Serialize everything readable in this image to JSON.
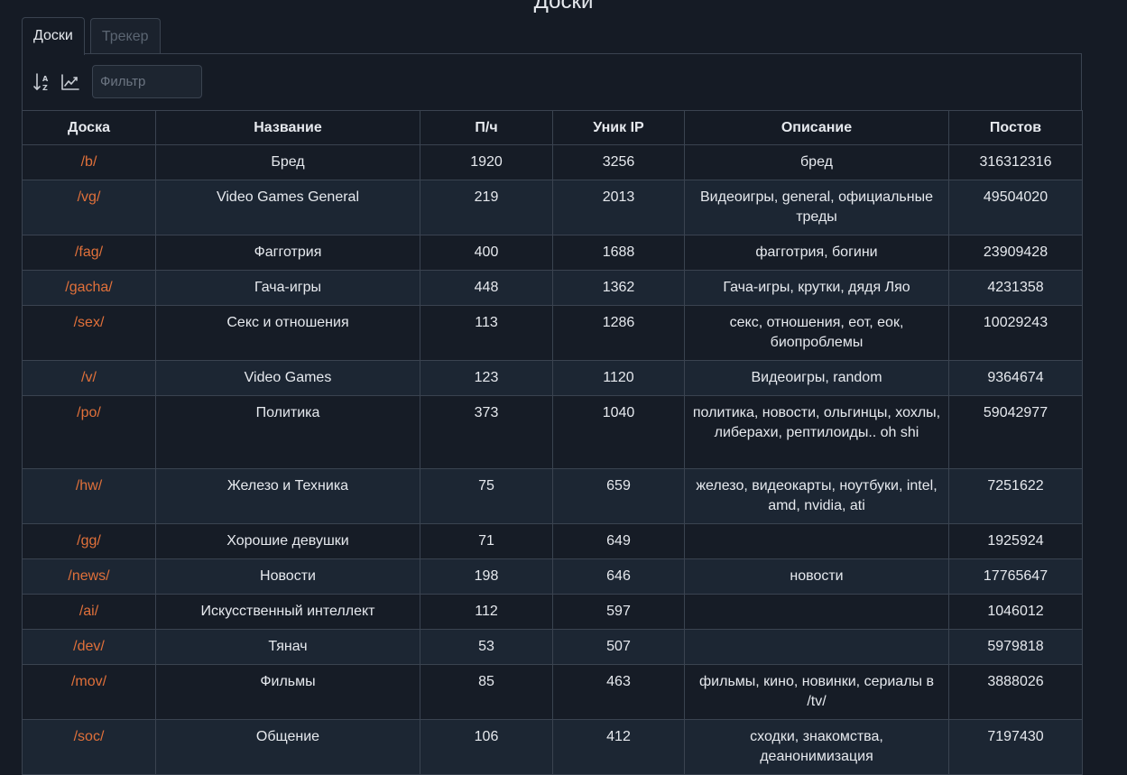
{
  "page": {
    "title": "Доски"
  },
  "tabs": [
    {
      "label": "Доски",
      "active": true
    },
    {
      "label": "Трекер",
      "active": false
    }
  ],
  "toolbar": {
    "sort_icon": "sort-alpha-icon",
    "chart_icon": "line-chart-icon",
    "filter_placeholder": "Фильтр",
    "filter_value": ""
  },
  "colors": {
    "background": "#151b25",
    "row_alt": "#1c2633",
    "border": "#3a4350",
    "link": "#e0703a",
    "text": "#e6e9ee"
  },
  "table": {
    "headers": [
      "Доска",
      "Название",
      "П/ч",
      "Уник IP",
      "Описание",
      "Постов"
    ],
    "rows": [
      {
        "board": "/b/",
        "name": "Бред",
        "pph": "1920",
        "unique_ip": "3256",
        "description": "бред",
        "posts": "316312316"
      },
      {
        "board": "/vg/",
        "name": "Video Games General",
        "pph": "219",
        "unique_ip": "2013",
        "description": "Видеоигры, general, официальные треды",
        "posts": "49504020"
      },
      {
        "board": "/fag/",
        "name": "Фагготрия",
        "pph": "400",
        "unique_ip": "1688",
        "description": "фагготрия, богини",
        "posts": "23909428"
      },
      {
        "board": "/gacha/",
        "name": "Гача-игры",
        "pph": "448",
        "unique_ip": "1362",
        "description": "Гача-игры, крутки, дядя Ляо",
        "posts": "4231358"
      },
      {
        "board": "/sex/",
        "name": "Секс и отношения",
        "pph": "113",
        "unique_ip": "1286",
        "description": "секс, отношения, еот, еок, биопроблемы",
        "posts": "10029243"
      },
      {
        "board": "/v/",
        "name": "Video Games",
        "pph": "123",
        "unique_ip": "1120",
        "description": "Видеоигры, random",
        "posts": "9364674"
      },
      {
        "board": "/po/",
        "name": "Политика",
        "pph": "373",
        "unique_ip": "1040",
        "description": "политика, новости, ольгинцы, хохлы, либерахи, рептилоиды.. oh shi",
        "posts": "59042977"
      },
      {
        "board": "/hw/",
        "name": "Железо и Техника",
        "pph": "75",
        "unique_ip": "659",
        "description": "железо, видеокарты, ноутбуки, intel, amd, nvidia, ati",
        "posts": "7251622"
      },
      {
        "board": "/gg/",
        "name": "Хорошие девушки",
        "pph": "71",
        "unique_ip": "649",
        "description": "",
        "posts": "1925924"
      },
      {
        "board": "/news/",
        "name": "Новости",
        "pph": "198",
        "unique_ip": "646",
        "description": "новости",
        "posts": "17765647"
      },
      {
        "board": "/ai/",
        "name": "Искусственный интеллект",
        "pph": "112",
        "unique_ip": "597",
        "description": "",
        "posts": "1046012"
      },
      {
        "board": "/dev/",
        "name": "Тянач",
        "pph": "53",
        "unique_ip": "507",
        "description": "",
        "posts": "5979818"
      },
      {
        "board": "/mov/",
        "name": "Фильмы",
        "pph": "85",
        "unique_ip": "463",
        "description": "фильмы, кино, новинки, сериалы в /tv/",
        "posts": "3888026"
      },
      {
        "board": "/soc/",
        "name": "Общение",
        "pph": "106",
        "unique_ip": "412",
        "description": "сходки, знакомства, деанонимизация",
        "posts": "7197430"
      }
    ]
  }
}
